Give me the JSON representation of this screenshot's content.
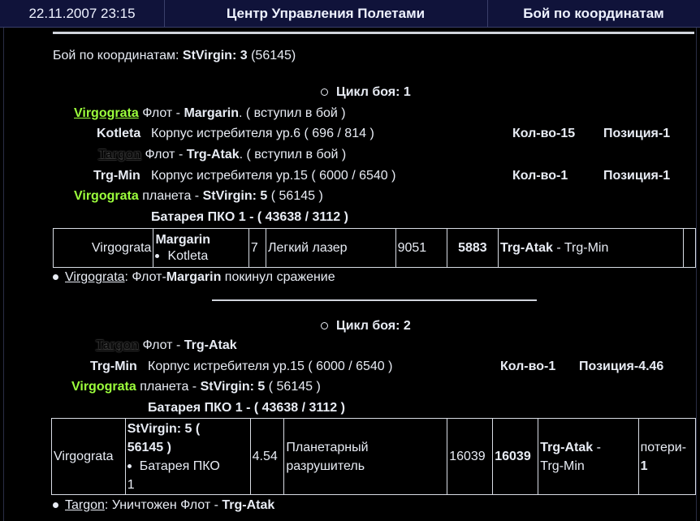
{
  "header": {
    "datetime": "22.11.2007 23:15",
    "center_title": "Центр Управления Полетами",
    "page_title": "Бой по координатам"
  },
  "summary": {
    "label": "Бой по координатам:",
    "planet": "StVirgin:",
    "num": "3",
    "code": "(56145)"
  },
  "cycle1": {
    "title": "Цикл боя: 1",
    "rows": {
      "r1_owner": "Virgograta",
      "r1_text_a": "Флот - ",
      "r1_fleet": "Margarin",
      "r1_text_b": ". ( вступил в бой )",
      "r2_name": "Kotleta",
      "r2_desc": "Корпус истребителя ур.6 ( 696 / 814 )",
      "r2_qty": "Кол-во-15",
      "r2_pos": "Позиция-1",
      "r3_owner": "Targon",
      "r3_text_a": "Флот - ",
      "r3_fleet": "Trg-Atak",
      "r3_text_b": ". ( вступил в бой )",
      "r4_name": "Trg-Min",
      "r4_desc": "Корпус истребителя ур.15 ( 6000 / 6540 )",
      "r4_qty": "Кол-во-1",
      "r4_pos": "Позиция-1",
      "r5_owner": "Virgograta",
      "r5_text_a": "планета - ",
      "r5_planet": "StVirgin:",
      "r5_num": "5",
      "r5_code": "( 56145 )",
      "r6_battery": "Батарея ПКО 1",
      "r6_rest": " - ( 43638 / 3112 )"
    },
    "table": {
      "owner": "Virgograta",
      "fleet": "Margarin",
      "unit": "Kotleta",
      "count": "7",
      "weapon": "Легкий лазер",
      "dmg1": "9051",
      "dmg2": "5883",
      "target_a": "Trg-Atak",
      "target_b": " - Trg-Min",
      "extra": ""
    },
    "event": {
      "owner": "Virgograta",
      "text_a": ": Флот-",
      "fleet": "Margarin",
      "text_b": " покинул сражение"
    }
  },
  "cycle2": {
    "title": "Цикл боя: 2",
    "rows": {
      "r1_owner": "Targon",
      "r1_text_a": "Флот - ",
      "r1_fleet": "Trg-Atak",
      "r2_name": "Trg-Min",
      "r2_desc": "Корпус истребителя ур.15 ( 6000 / 6540 )",
      "r2_qty": "Кол-во-1",
      "r2_pos_a": "Позиция-",
      "r2_pos_b": "4.46",
      "r3_owner": "Virgograta",
      "r3_text_a": "планета - ",
      "r3_planet": "StVirgin:",
      "r3_num": "5",
      "r3_code": "( 56145 )",
      "r4_battery": "Батарея ПКО 1",
      "r4_rest": " - ( 43638 / 3112 )"
    },
    "table": {
      "owner": "Virgograta",
      "planet_line1": "StVirgin: 5 (",
      "planet_line2": "56145 )",
      "unit": "Батарея ПКО",
      "unit_num": "1",
      "coef": "4.54",
      "weapon_l1": "Планетарный",
      "weapon_l2": "разрушитель",
      "dmg1": "16039",
      "dmg2": "16039",
      "target_a": "Trg-Atak",
      "target_b": " -",
      "target_c": "Trg-Min",
      "loss_a": "потери-",
      "loss_b": "1"
    },
    "event": {
      "owner": "Targon",
      "text_a": ": Уничтожен Флот - ",
      "fleet": "Trg-Atak"
    }
  },
  "colors": {
    "background": "#000000",
    "header_bg": "#10133a",
    "player_green": "#9cff3c",
    "text": "#e8ecf4"
  }
}
